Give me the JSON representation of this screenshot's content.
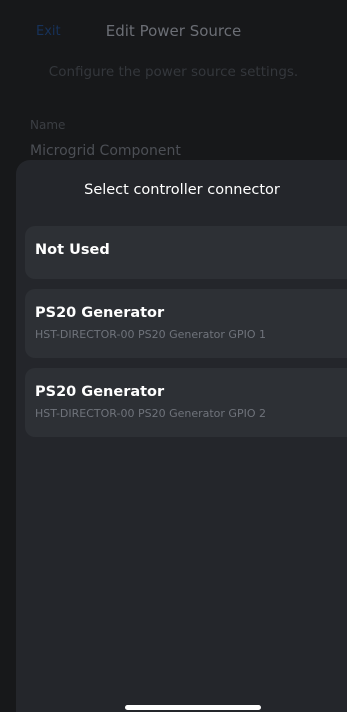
{
  "background": {
    "exit_label": "Exit",
    "title": "Edit Power Source",
    "subtitle": "Configure the power source settings.",
    "name_label": "Name",
    "name_value": "Microgrid Component"
  },
  "sheet": {
    "title": "Select controller connector",
    "options": [
      {
        "title": "Not Used",
        "subtitle": ""
      },
      {
        "title": "PS20 Generator",
        "subtitle": "HST-DIRECTOR-00 PS20 Generator GPIO 1"
      },
      {
        "title": "PS20 Generator",
        "subtitle": "HST-DIRECTOR-00 PS20 Generator GPIO 2"
      }
    ]
  },
  "colors": {
    "sheet_background": "#24262b",
    "option_background": "#2d3035",
    "exit_link": "#17325a"
  }
}
